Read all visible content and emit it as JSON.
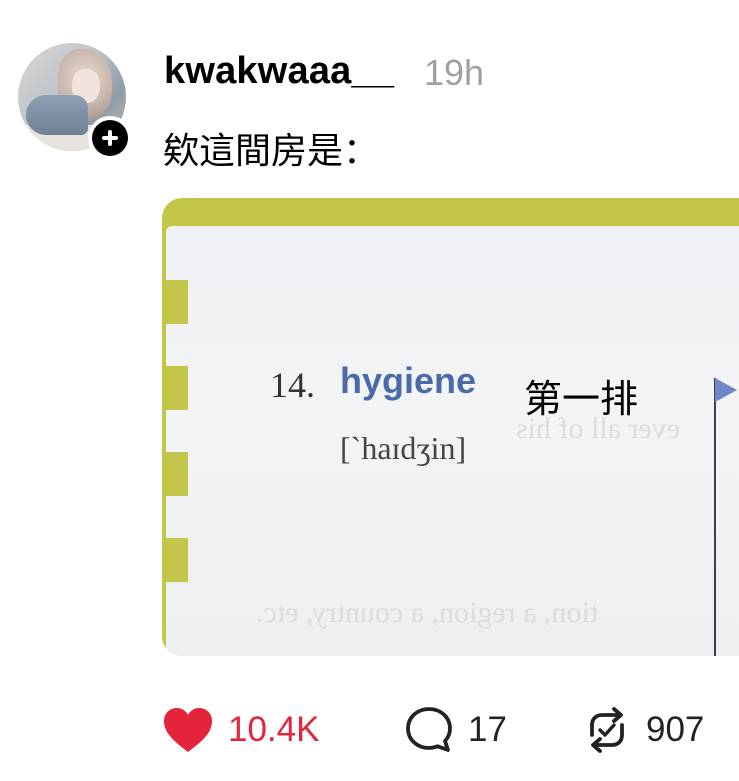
{
  "post": {
    "username": "kwakwaaa__",
    "timestamp": "19h",
    "caption": "欸這間房是："
  },
  "image": {
    "entry_number": "14.",
    "word": "hygiene",
    "phonetic": "[`haɪdʒin]",
    "overlay_text": "第一排",
    "ghost_lines": [
      "ever all of his",
      "tion, a region, a country, etc."
    ]
  },
  "actions": {
    "likes": "10.4K",
    "replies": "17",
    "reposts": "907"
  },
  "colors": {
    "like": "#e3243b",
    "timestamp": "#a0a0a0",
    "word_blue": "#4a6aa8",
    "tab_yellow": "#c2c64a"
  },
  "icons": [
    "heart-icon",
    "comment-icon",
    "repost-icon",
    "plus-icon"
  ]
}
